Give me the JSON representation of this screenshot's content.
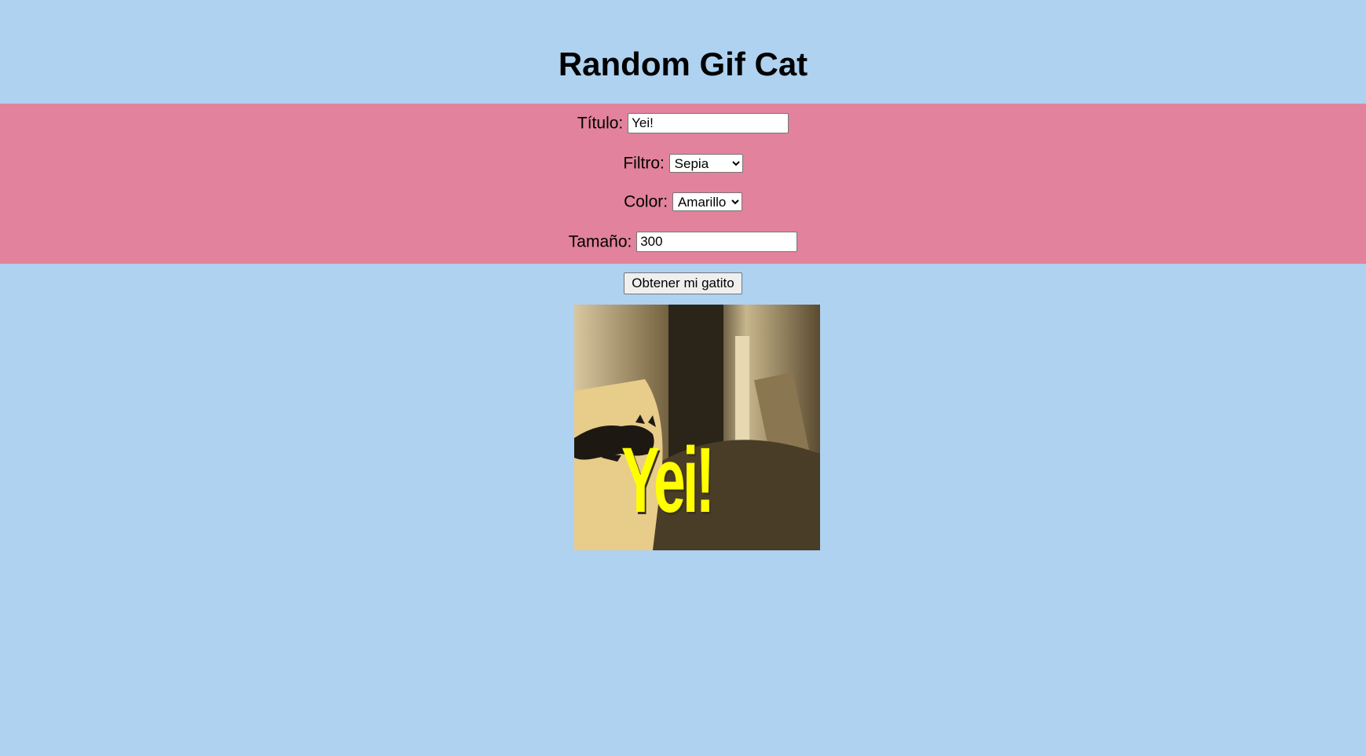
{
  "page": {
    "title": "Random Gif Cat"
  },
  "form": {
    "titulo_label": "Título:",
    "titulo_value": "Yei!",
    "filtro_label": "Filtro:",
    "filtro_value": "Sepia",
    "color_label": "Color:",
    "color_value": "Amarillo",
    "tamano_label": "Tamaño:",
    "tamano_value": "300",
    "submit_label": "Obtener mi gatito"
  },
  "gif": {
    "caption": "Yei!",
    "caption_color": "#ffff00"
  },
  "colors": {
    "background": "#aed2f0",
    "form_band": "#e2829c"
  }
}
